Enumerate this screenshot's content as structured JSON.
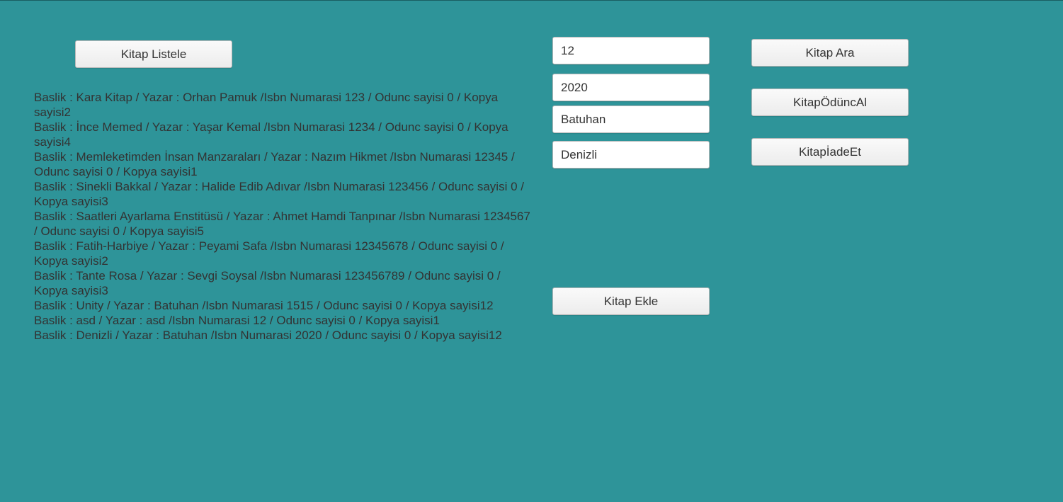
{
  "buttons": {
    "list_books": "Kitap Listele",
    "search_book": "Kitap Ara",
    "borrow_book": "KitapÖdüncAl",
    "return_book": "KitapİadeEt",
    "add_book": "Kitap Ekle"
  },
  "inputs": {
    "field1": {
      "value": "12"
    },
    "field2": {
      "value": "2020"
    },
    "field3": {
      "value": "Batuhan"
    },
    "field4": {
      "value": "Denizli"
    }
  },
  "books": [
    "Baslik :  Kara Kitap / Yazar : Orhan Pamuk /Isbn Numarasi 123 / Odunc sayisi 0  / Kopya sayisi2",
    "Baslik :  İnce Memed / Yazar : Yaşar Kemal /Isbn Numarasi 1234 / Odunc sayisi 0  / Kopya sayisi4",
    "Baslik :  Memleketimden İnsan Manzaraları / Yazar : Nazım Hikmet /Isbn Numarasi 12345 / Odunc sayisi 0  / Kopya sayisi1",
    "Baslik :  Sinekli Bakkal / Yazar : Halide Edib Adıvar /Isbn Numarasi 123456 / Odunc sayisi 0  / Kopya sayisi3",
    "Baslik :  Saatleri Ayarlama Enstitüsü / Yazar : Ahmet Hamdi Tanpınar /Isbn Numarasi 1234567 / Odunc sayisi 0  / Kopya sayisi5",
    "Baslik :  Fatih-Harbiye / Yazar : Peyami Safa /Isbn Numarasi 12345678 / Odunc sayisi 0  / Kopya sayisi2",
    "Baslik :  Tante Rosa / Yazar : Sevgi Soysal /Isbn Numarasi 123456789 / Odunc sayisi 0  / Kopya sayisi3",
    "Baslik :  Unity / Yazar : Batuhan /Isbn Numarasi 1515 / Odunc sayisi 0  / Kopya sayisi12",
    "Baslik :  asd / Yazar : asd /Isbn Numarasi 12 / Odunc sayisi 0  / Kopya sayisi1",
    "Baslik :  Denizli / Yazar : Batuhan  /Isbn Numarasi 2020 / Odunc sayisi 0  / Kopya sayisi12"
  ]
}
